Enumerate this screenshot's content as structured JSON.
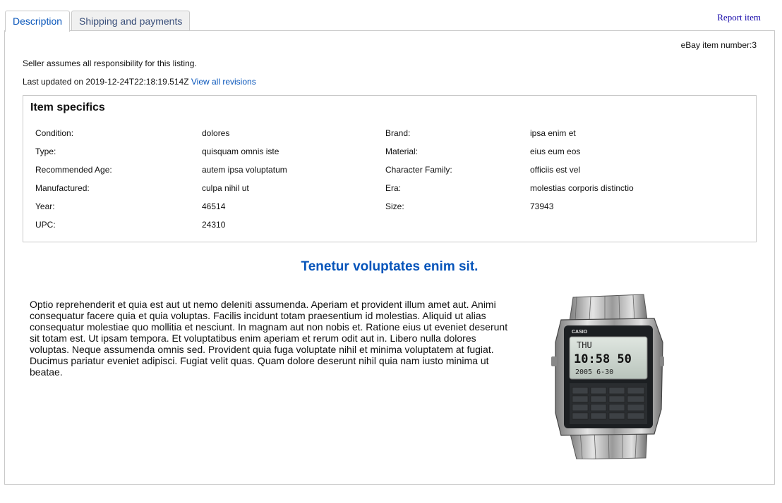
{
  "tabs": [
    {
      "label": "Description",
      "active": true
    },
    {
      "label": "Shipping and payments",
      "active": false
    }
  ],
  "report_link": "Report item",
  "item_number": "eBay item number:3",
  "responsibility": "Seller assumes all responsibility for this listing.",
  "last_updated": {
    "text": "Last updated on 2019-12-24T22:18:19.514Z",
    "link": "View all revisions"
  },
  "item_specifics": {
    "title": "Item specifics",
    "rows": [
      [
        {
          "label": "Condition:",
          "value": "dolores"
        },
        {
          "label": "Brand:",
          "value": "ipsa enim et"
        }
      ],
      [
        {
          "label": "Type:",
          "value": "quisquam omnis iste"
        },
        {
          "label": "Material:",
          "value": "eius eum eos"
        }
      ],
      [
        {
          "label": "Recommended Age:",
          "value": "autem ipsa voluptatum"
        },
        {
          "label": "Character Family:",
          "value": "officiis est vel"
        }
      ],
      [
        {
          "label": "Manufactured:",
          "value": "culpa nihil ut"
        },
        {
          "label": "Era:",
          "value": "molestias corporis distinctio"
        }
      ],
      [
        {
          "label": "Year:",
          "value": "46514"
        },
        {
          "label": "Size:",
          "value": "73943"
        }
      ],
      [
        {
          "label": "UPC:",
          "value": "24310"
        },
        {
          "label": "",
          "value": ""
        }
      ]
    ]
  },
  "headline": "Tenetur voluptates enim sit.",
  "description": "Optio reprehenderit et quia est aut ut nemo deleniti assumenda. Aperiam et provident illum amet aut. Animi consequatur facere quia et quia voluptas. Facilis incidunt totam praesentium id molestias. Aliquid ut alias consequatur molestiae quo mollitia et nesciunt. In magnam aut non nobis et. Ratione eius ut eveniet deserunt sit totam est. Ut ipsam tempora. Et voluptatibus enim aperiam et rerum odit aut in. Libero nulla dolores voluptas. Neque assumenda omnis sed. Provident quia fuga voluptate nihil et minima voluptatem at fugiat. Ducimus pariatur eveniet adipisci. Fugiat velit quas. Quam dolore deserunt nihil quia nam iusto minima ut beatae.",
  "product_image": {
    "icon": "calculator-watch-image",
    "brand_text": "CASIO",
    "day": "THU",
    "time": "10:58 50",
    "date": "2005  6-30"
  }
}
